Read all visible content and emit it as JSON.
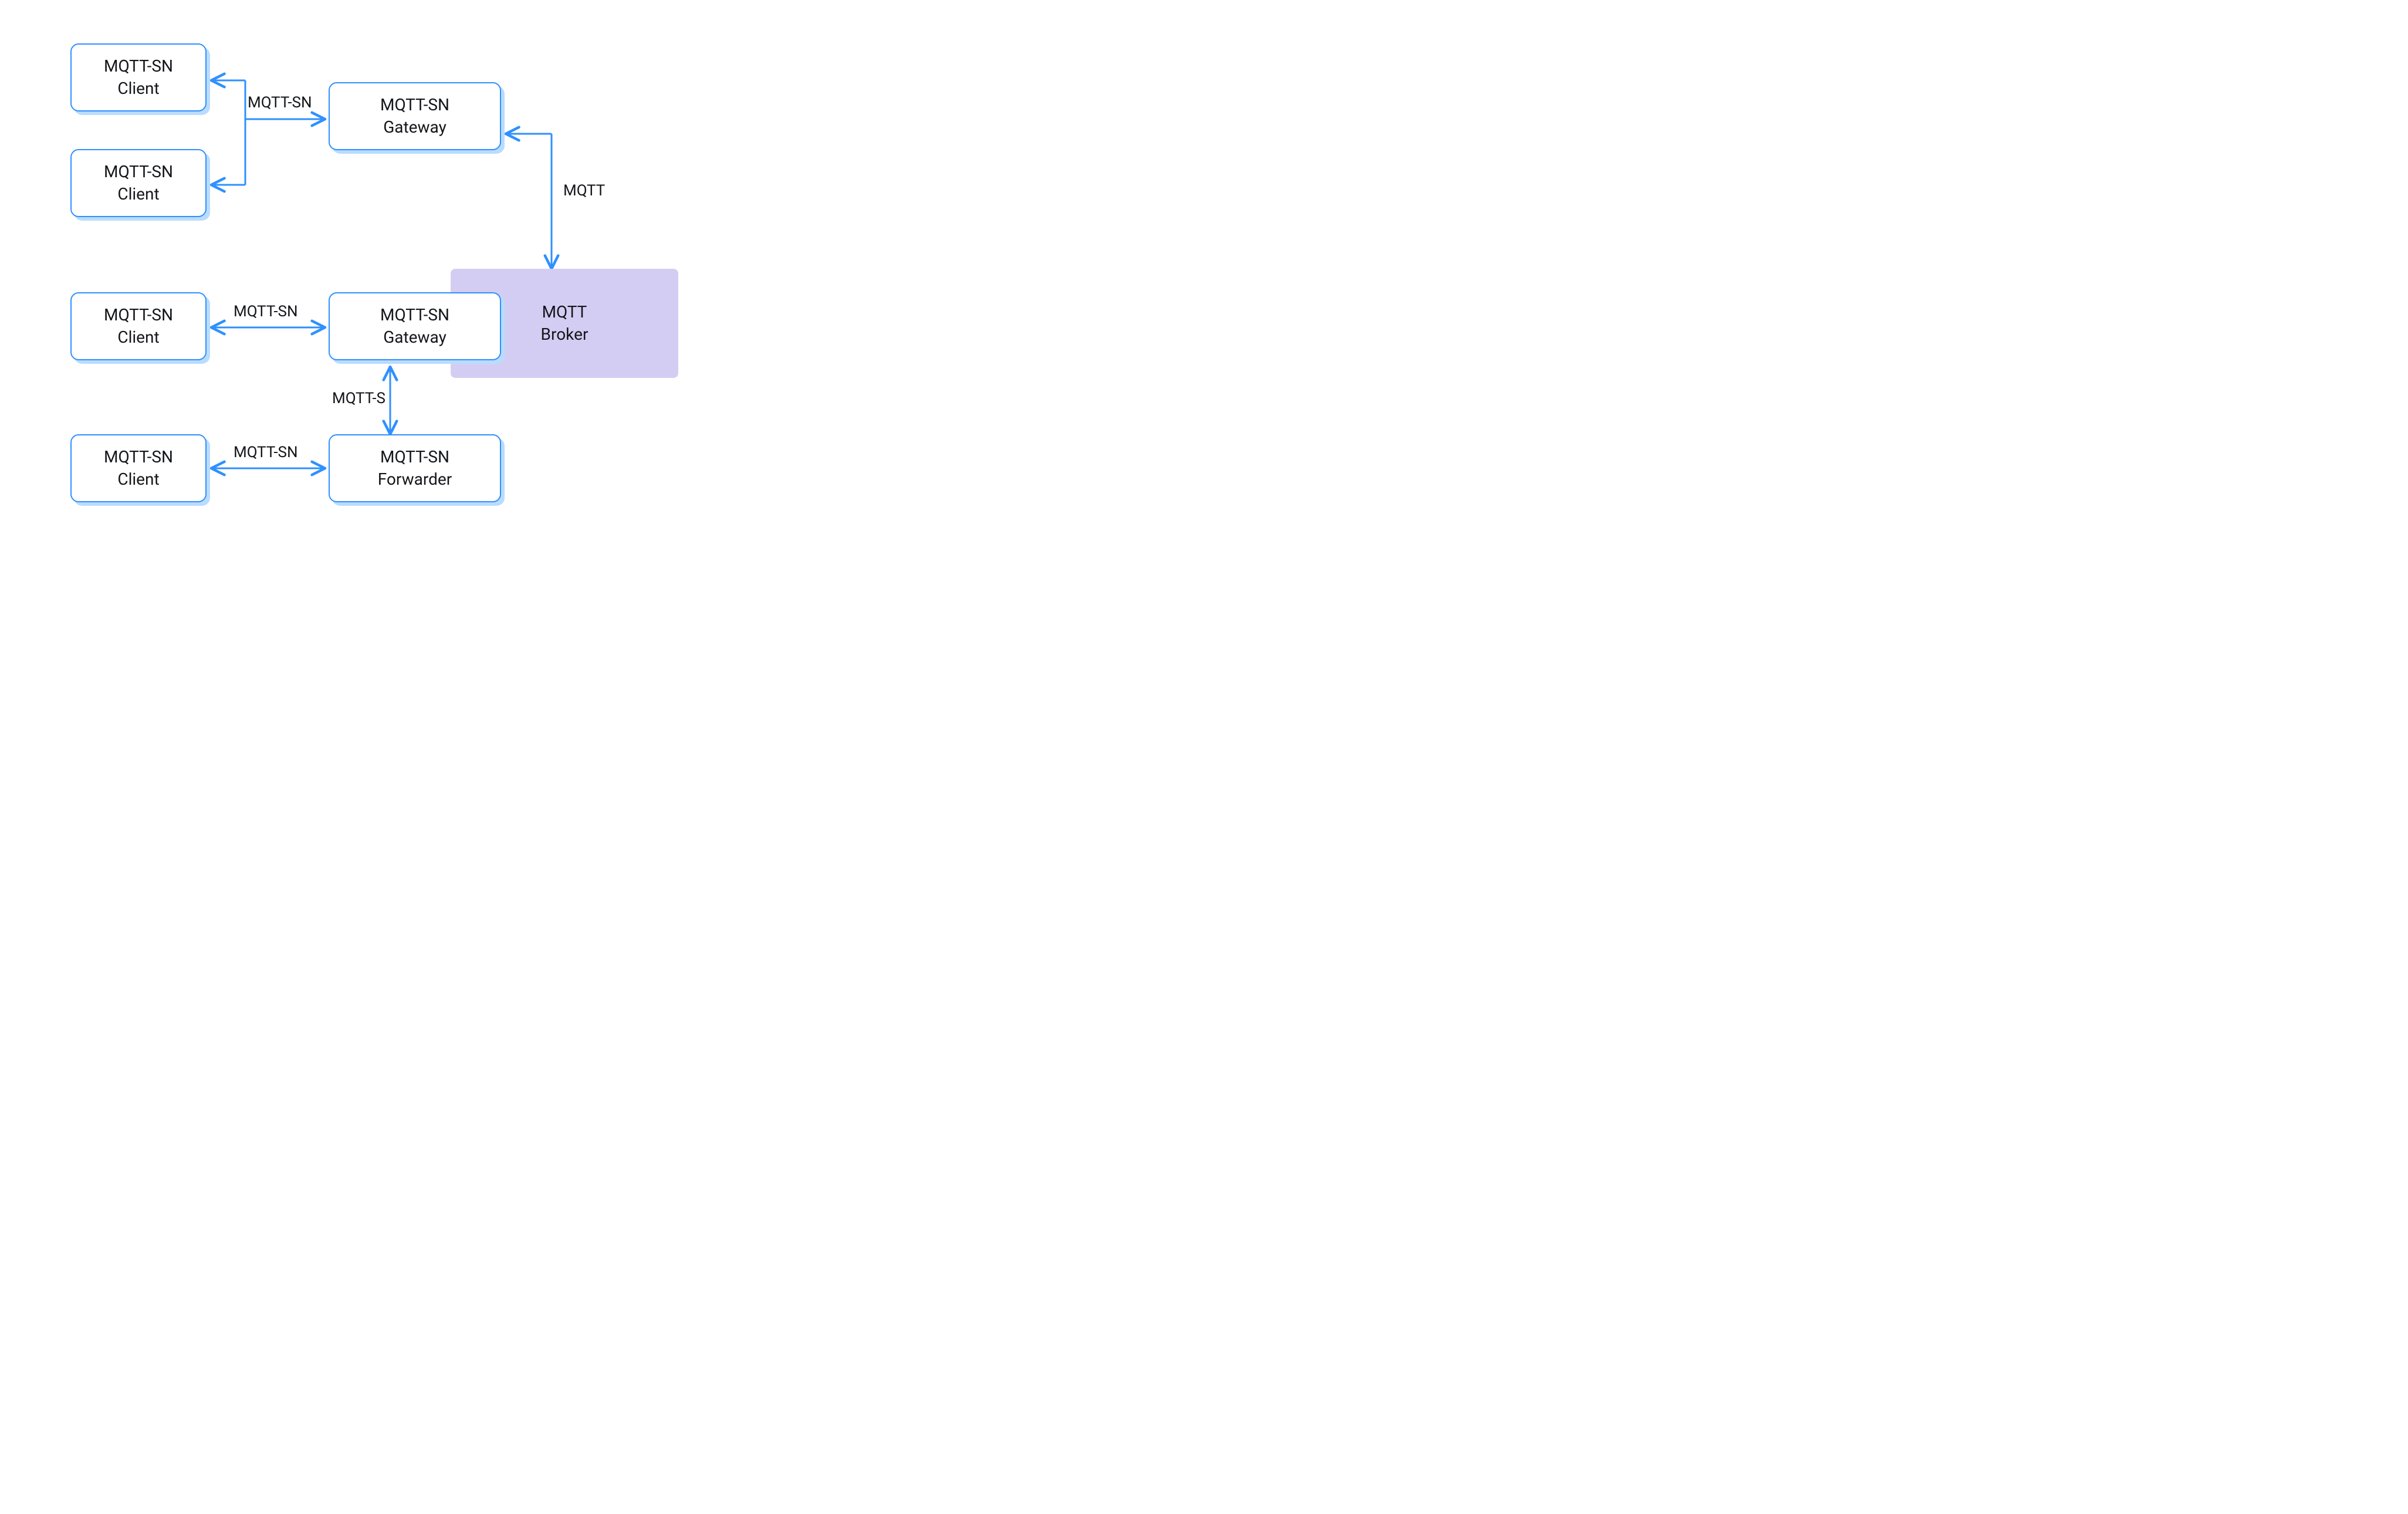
{
  "colors": {
    "edge": "#2f90ff",
    "nodeBorder": "#2f90ff",
    "nodeShadow": "#b9dcff",
    "broker": "#d4cdf3",
    "text": "#14161a"
  },
  "nodes": {
    "client1": {
      "line1": "MQTT-SN",
      "line2": "Client"
    },
    "client2": {
      "line1": "MQTT-SN",
      "line2": "Client"
    },
    "client3": {
      "line1": "MQTT-SN",
      "line2": "Client"
    },
    "client4": {
      "line1": "MQTT-SN",
      "line2": "Client"
    },
    "gateway1": {
      "line1": "MQTT-SN",
      "line2": "Gateway"
    },
    "gateway2": {
      "line1": "MQTT-SN",
      "line2": "Gateway"
    },
    "forwarder": {
      "line1": "MQTT-SN",
      "line2": "Forwarder"
    },
    "broker": {
      "line1": "MQTT",
      "line2": "Broker"
    }
  },
  "edgeLabels": {
    "e1": "MQTT-SN",
    "e2": "MQTT",
    "e3": "MQTT-SN",
    "e4": "MQTT-S",
    "e5": "MQTT-SN"
  }
}
